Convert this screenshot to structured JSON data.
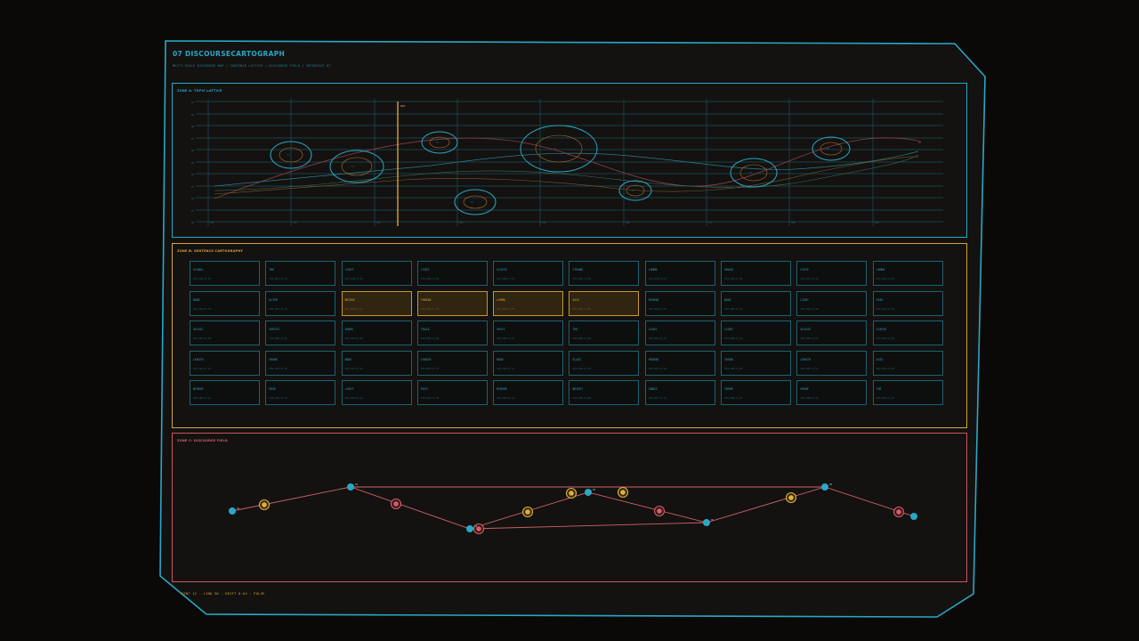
{
  "app": {
    "title": "07 DISCOURSECARTOGRAPH",
    "subtitle": "MULTI-SCALE DISCOURSE MAP / SENTENCE LATTICE / DISCOURSE FIELD / INTERFACE 07"
  },
  "zones": {
    "a": {
      "label": "ZONE A: TOPIC LATTICE",
      "marker_label": "NOW"
    },
    "b": {
      "label": "ZONE B: SENTENCE CARTOGRAPHY"
    },
    "c": {
      "label": "ZONE C: DISCOURSE FIELD"
    }
  },
  "colors": {
    "cyan": "#2aa7c4",
    "amber": "#d4a43c",
    "rose": "#d0616b",
    "background": "#131210"
  },
  "topic_lattice": {
    "y_ticks": [
      "10",
      "09",
      "08",
      "07",
      "06",
      "05",
      "04",
      "03",
      "02",
      "01",
      "00"
    ],
    "x_ticks": [
      "T01",
      "T02",
      "T03",
      "T04",
      "T05",
      "T06",
      "T07",
      "T08",
      "T09"
    ],
    "topic_nodes": [
      {
        "id": "t1",
        "label": "T1"
      },
      {
        "id": "t2",
        "label": "T2"
      },
      {
        "id": "t3",
        "label": "T3"
      },
      {
        "id": "t4",
        "label": "T4"
      },
      {
        "id": "t5",
        "label": "T5"
      },
      {
        "id": "t6",
        "label": "T6"
      },
      {
        "id": "t7",
        "label": "T7"
      },
      {
        "id": "t8",
        "label": "T8"
      }
    ]
  },
  "sentence_tiles": [
    [
      {
        "w": "SIGNAL",
        "m": "S01·W12·0.61"
      },
      {
        "w": "THE",
        "m": "S01·W01·0.20"
      },
      {
        "w": "LIGHT",
        "m": "S01·W05·0.44"
      },
      {
        "w": "LIGHT",
        "m": "S01·W06·0.44"
      },
      {
        "w": "SLEEVE",
        "m": "S01·W08·0.52"
      },
      {
        "w": "STRAND",
        "m": "S01·W09·0.58"
      },
      {
        "w": "LEMMA",
        "m": "S01·W10·0.47"
      },
      {
        "w": "GRAIN",
        "m": "S01·W11·0.39"
      },
      {
        "w": "STATE",
        "m": "S01·W13·0.42"
      },
      {
        "w": "LEMMA",
        "m": "S01·W14·0.47"
      }
    ],
    [
      {
        "w": "NODE",
        "m": "S02·W02·0.33"
      },
      {
        "w": "GLYPH",
        "m": "S02·W03·0.36"
      },
      {
        "w": "BRIDGE",
        "m": "S02·W04·0.72",
        "hl": true
      },
      {
        "w": "THREAD",
        "m": "S02·W05·0.70",
        "hl": true
      },
      {
        "w": "LEMMA",
        "m": "S02·W06·0.68",
        "hl": true
      },
      {
        "w": "AXIS",
        "m": "S02·W07·0.66",
        "hl": true
      },
      {
        "w": "MIRROR",
        "m": "S02·W08·0.41"
      },
      {
        "w": "NODE",
        "m": "S02·W09·0.33"
      },
      {
        "w": "LIGHT",
        "m": "S02·W10·0.44"
      },
      {
        "w": "PATH",
        "m": "S02·W11·0.38"
      }
    ],
    [
      {
        "w": "VESSEL",
        "m": "S03·W01·0.49"
      },
      {
        "w": "VERTEX",
        "m": "S03·W02·0.51"
      },
      {
        "w": "SHORE",
        "m": "S03·W03·0.45"
      },
      {
        "w": "TRACE",
        "m": "S03·W04·0.40"
      },
      {
        "w": "SHIFT",
        "m": "S03·W05·0.43"
      },
      {
        "w": "THE",
        "m": "S03·W06·0.20"
      },
      {
        "w": "LIGHT",
        "m": "S03·W07·0.44"
      },
      {
        "w": "LIGHT",
        "m": "S03·W08·0.44"
      },
      {
        "w": "SLEEVE",
        "m": "S03·W09·0.52"
      },
      {
        "w": "SLEEVE",
        "m": "S03·W10·0.52"
      }
    ],
    [
      {
        "w": "LENGTH",
        "m": "S04·W01·0.37"
      },
      {
        "w": "SHORE",
        "m": "S04·W02·0.45"
      },
      {
        "w": "NODE",
        "m": "S04·W03·0.33"
      },
      {
        "w": "LENGTH",
        "m": "S04·W04·0.37"
      },
      {
        "w": "NODE",
        "m": "S04·W05·0.33"
      },
      {
        "w": "GLASS",
        "m": "S04·W06·0.35"
      },
      {
        "w": "PROVED",
        "m": "S04·W07·0.50"
      },
      {
        "w": "TREND",
        "m": "S04·W08·0.46"
      },
      {
        "w": "LENGTH",
        "m": "S04·W09·0.37"
      },
      {
        "w": "AXIS",
        "m": "S04·W10·0.66"
      }
    ],
    [
      {
        "w": "MIRROR",
        "m": "S05·W01·0.41"
      },
      {
        "w": "EDGE",
        "m": "S05·W02·0.30"
      },
      {
        "w": "LIGHT",
        "m": "S05·W03·0.44"
      },
      {
        "w": "PATH",
        "m": "S05·W04·0.38"
      },
      {
        "w": "MIRROR",
        "m": "S05·W05·0.41"
      },
      {
        "w": "WEIGHT",
        "m": "S05·W06·0.48"
      },
      {
        "w": "INDEX",
        "m": "S05·W07·0.31"
      },
      {
        "w": "THEME",
        "m": "S05·W08·0.53"
      },
      {
        "w": "SHORE",
        "m": "S05·W09·0.45"
      },
      {
        "w": "THE",
        "m": "S05·W10·0.20"
      }
    ]
  ],
  "discourse_field": {
    "nodes": [
      {
        "id": "n1",
        "label": "01"
      },
      {
        "id": "n2",
        "label": "02"
      },
      {
        "id": "n3",
        "label": "03"
      },
      {
        "id": "n4",
        "label": "04"
      },
      {
        "id": "n5",
        "label": "05"
      },
      {
        "id": "n6",
        "label": "06"
      }
    ]
  },
  "status_bar": "SENT 12 · LINK 38 · DRIFT 0.64 · PULSE"
}
